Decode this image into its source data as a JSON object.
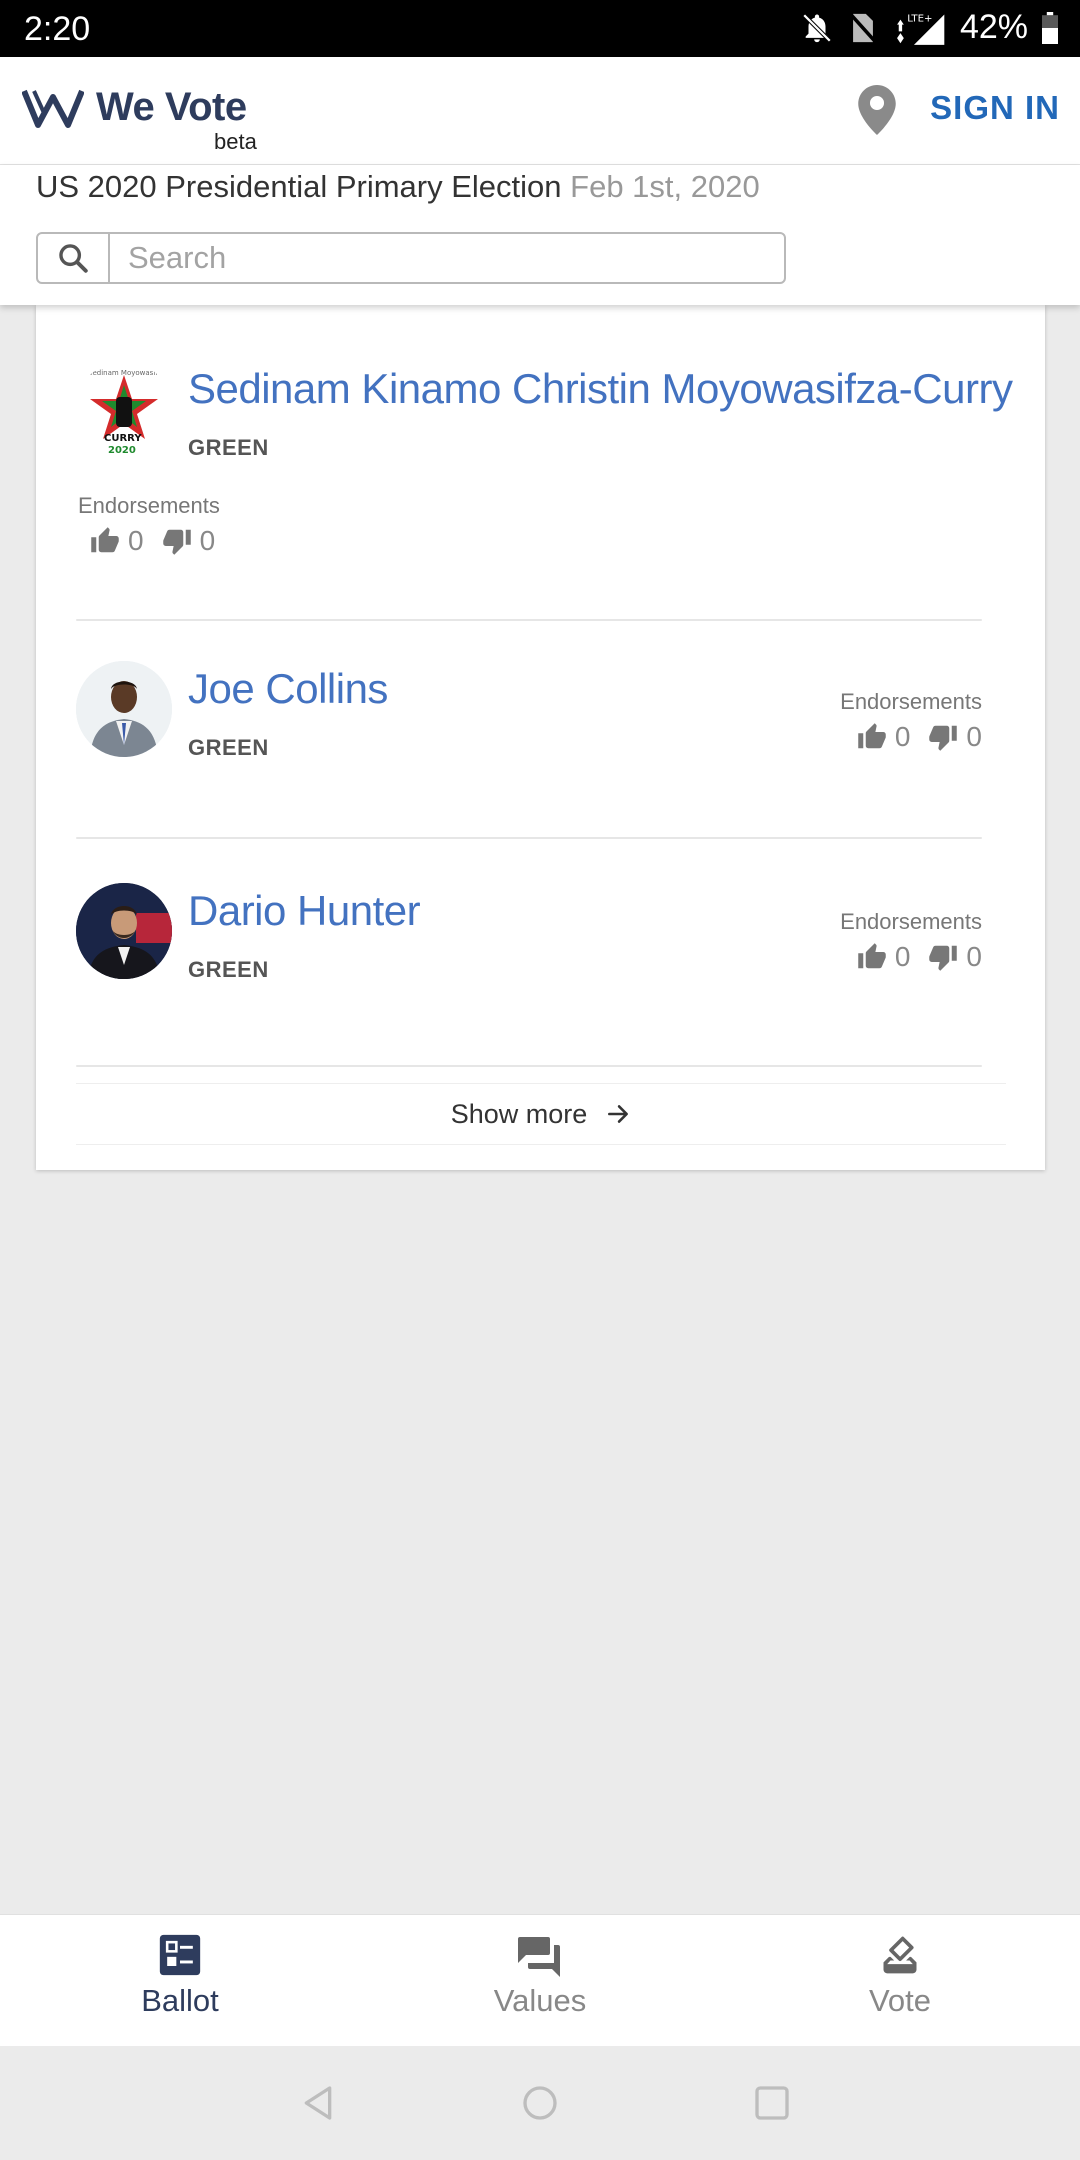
{
  "status_bar": {
    "time": "2:20",
    "battery": "42%",
    "network": "LTE+"
  },
  "header": {
    "brand": "We Vote",
    "beta": "beta",
    "sign_in": "SIGN IN"
  },
  "election": {
    "title": "US 2020 Presidential Primary Election",
    "date": "Feb 1st, 2020"
  },
  "search": {
    "placeholder": "Search",
    "value": ""
  },
  "candidates": [
    {
      "name": "Sedinam Kinamo Christin Moyowasifza-Curry",
      "party": "GREEN",
      "endorsements_label": "Endorsements",
      "support": "0",
      "oppose": "0"
    },
    {
      "name": "Joe Collins",
      "party": "GREEN",
      "endorsements_label": "Endorsements",
      "support": "0",
      "oppose": "0"
    },
    {
      "name": "Dario Hunter",
      "party": "GREEN",
      "endorsements_label": "Endorsements",
      "support": "0",
      "oppose": "0"
    }
  ],
  "show_more": "Show more",
  "bottom_nav": [
    {
      "label": "Ballot",
      "icon": "ballot-icon",
      "active": true
    },
    {
      "label": "Values",
      "icon": "values-icon",
      "active": false
    },
    {
      "label": "Vote",
      "icon": "vote-icon",
      "active": false
    }
  ],
  "colors": {
    "brand_navy": "#2e3c5d",
    "link_blue": "#4372c0",
    "sign_in_blue": "#2268b8"
  }
}
